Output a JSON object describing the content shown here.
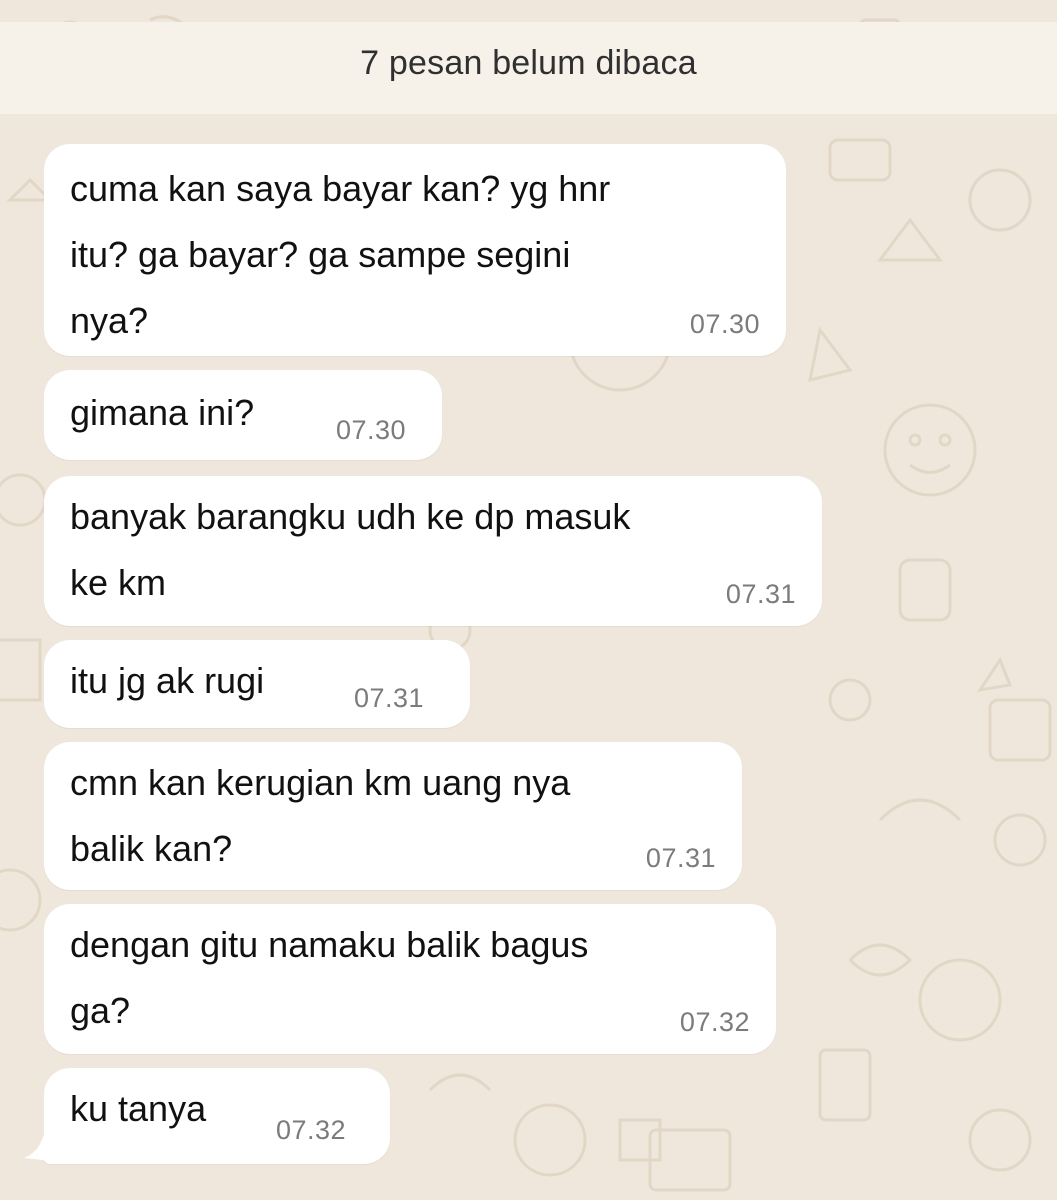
{
  "banner": {
    "text": "7 pesan belum dibaca"
  },
  "messages": [
    {
      "text": "cuma kan saya bayar kan? yg hnr\nitu? ga bayar? ga sampe segini\nnya?",
      "time": "07.30"
    },
    {
      "text": "gimana ini?",
      "time": "07.30"
    },
    {
      "text": "banyak barangku udh ke dp masuk\nke km",
      "time": "07.31"
    },
    {
      "text": "itu jg ak rugi",
      "time": "07.31"
    },
    {
      "text": "cmn kan kerugian km uang nya\nbalik kan?",
      "time": "07.31"
    },
    {
      "text": "dengan gitu namaku balik bagus\nga?",
      "time": "07.32"
    },
    {
      "text": "ku tanya",
      "time": "07.32"
    }
  ],
  "colors": {
    "wallpaper": "#efe7dc",
    "wallpaper_doodle": "#e4dacb",
    "bubble": "#ffffff",
    "time": "#7b7b7b"
  }
}
